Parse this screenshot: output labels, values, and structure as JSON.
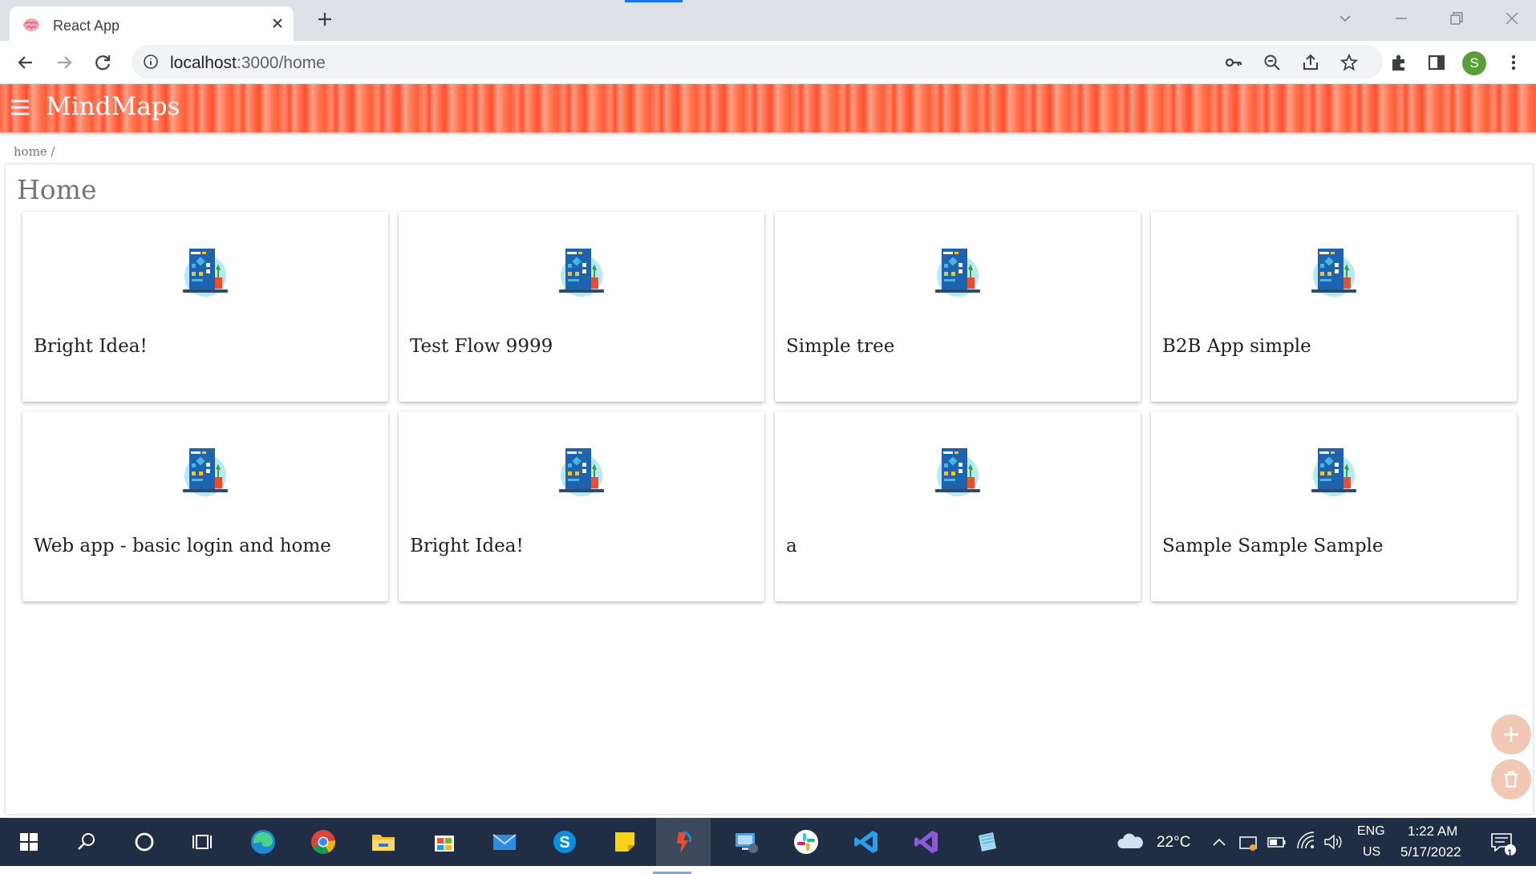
{
  "browser": {
    "tab_title": "React App",
    "url_host": "localhost",
    "url_rest": ":3000/home",
    "profile_initial": "S"
  },
  "app": {
    "title": "MindMaps",
    "breadcrumb": "home /",
    "page_title": "Home"
  },
  "cards": [
    {
      "title": "Bright Idea!"
    },
    {
      "title": "Test Flow 9999"
    },
    {
      "title": "Simple tree"
    },
    {
      "title": "B2B App simple"
    },
    {
      "title": "Web app - basic login and home"
    },
    {
      "title": "Bright Idea!"
    },
    {
      "title": "a"
    },
    {
      "title": "Sample Sample Sample"
    }
  ],
  "taskbar": {
    "weather": "22°C",
    "lang_top": "ENG",
    "lang_bottom": "US",
    "time": "1:22 AM",
    "date": "5/17/2022",
    "notification_count": "1"
  },
  "colors": {
    "appbar": "#ff6a48",
    "fab": "#f1c8b3",
    "taskbar": "#1f2e45"
  }
}
